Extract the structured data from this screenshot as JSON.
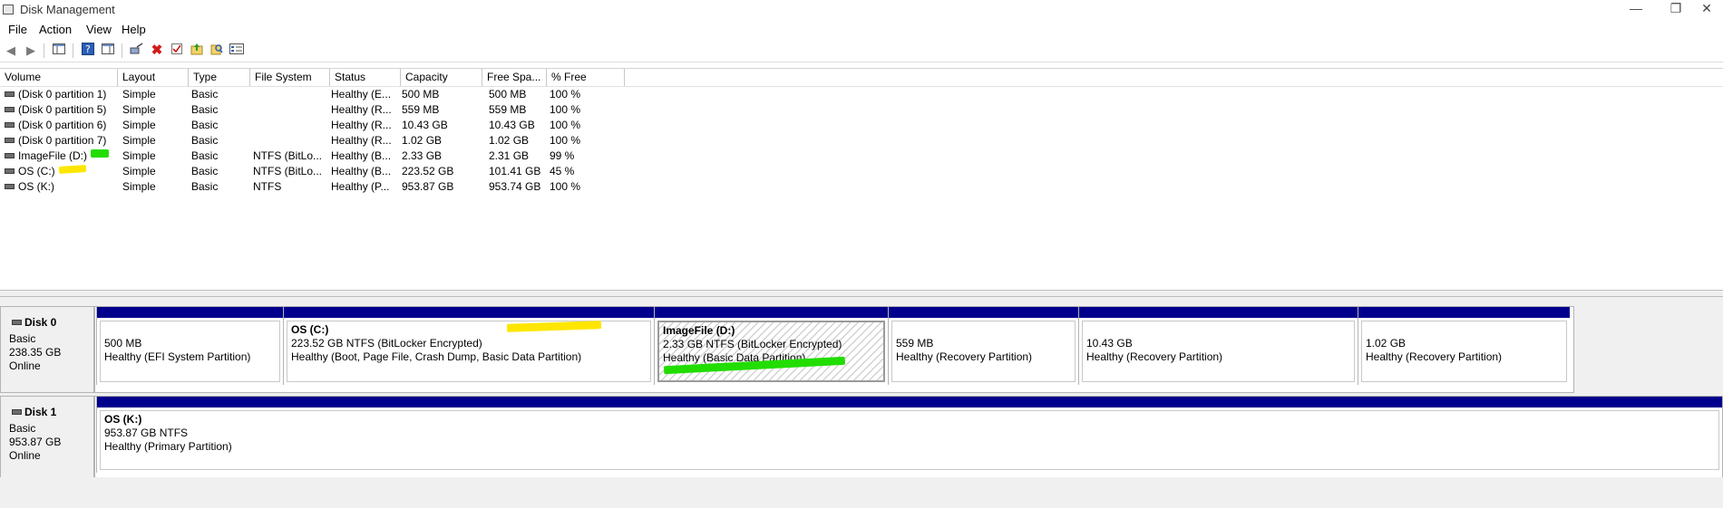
{
  "window": {
    "title": "Disk Management",
    "controls": [
      "—",
      "❐",
      "✕"
    ]
  },
  "menu": [
    "File",
    "Action",
    "View",
    "Help"
  ],
  "toolbar_icons": [
    "back-arrow-icon",
    "forward-arrow-icon",
    "console-tree-icon",
    "help-icon",
    "show-pane-icon",
    "connect-icon",
    "delete-icon",
    "properties-icon",
    "import-icon",
    "search-icon",
    "list-view-icon"
  ],
  "columns": [
    "Volume",
    "Layout",
    "Type",
    "File System",
    "Status",
    "Capacity",
    "Free Spa...",
    "% Free"
  ],
  "volumes": [
    {
      "volume": "(Disk 0 partition 1)",
      "layout": "Simple",
      "type": "Basic",
      "fs": "",
      "status": "Healthy (E...",
      "capacity": "500 MB",
      "free": "500 MB",
      "pct": "100 %"
    },
    {
      "volume": "(Disk 0 partition 5)",
      "layout": "Simple",
      "type": "Basic",
      "fs": "",
      "status": "Healthy (R...",
      "capacity": "559 MB",
      "free": "559 MB",
      "pct": "100 %"
    },
    {
      "volume": "(Disk 0 partition 6)",
      "layout": "Simple",
      "type": "Basic",
      "fs": "",
      "status": "Healthy (R...",
      "capacity": "10.43 GB",
      "free": "10.43 GB",
      "pct": "100 %"
    },
    {
      "volume": "(Disk 0 partition 7)",
      "layout": "Simple",
      "type": "Basic",
      "fs": "",
      "status": "Healthy (R...",
      "capacity": "1.02 GB",
      "free": "1.02 GB",
      "pct": "100 %"
    },
    {
      "volume": "ImageFile (D:)",
      "layout": "Simple",
      "type": "Basic",
      "fs": "NTFS (BitLo...",
      "status": "Healthy (B...",
      "capacity": "2.33 GB",
      "free": "2.31 GB",
      "pct": "99 %"
    },
    {
      "volume": "OS (C:)",
      "layout": "Simple",
      "type": "Basic",
      "fs": "NTFS (BitLo...",
      "status": "Healthy (B...",
      "capacity": "223.52 GB",
      "free": "101.41 GB",
      "pct": "45 %"
    },
    {
      "volume": "OS (K:)",
      "layout": "Simple",
      "type": "Basic",
      "fs": "NTFS",
      "status": "Healthy (P...",
      "capacity": "953.87 GB",
      "free": "953.74 GB",
      "pct": "100 %"
    }
  ],
  "highlight_colors": {
    "green": "#22dd00",
    "yellow": "#ffe600"
  },
  "disks": [
    {
      "name": "Disk 0",
      "type": "Basic",
      "size": "238.35 GB",
      "state": "Online",
      "partitions": [
        {
          "name": "",
          "size": "500 MB",
          "status": "Healthy (EFI System Partition)"
        },
        {
          "name": "OS  (C:)",
          "size": "223.52 GB NTFS (BitLocker Encrypted)",
          "status": "Healthy (Boot, Page File, Crash Dump, Basic Data Partition)"
        },
        {
          "name": "ImageFile  (D:)",
          "size": "2.33 GB NTFS (BitLocker Encrypted)",
          "status": "Healthy (Basic Data Partition)"
        },
        {
          "name": "",
          "size": "559 MB",
          "status": "Healthy (Recovery Partition)"
        },
        {
          "name": "",
          "size": "10.43 GB",
          "status": "Healthy (Recovery Partition)"
        },
        {
          "name": "",
          "size": "1.02 GB",
          "status": "Healthy (Recovery Partition)"
        }
      ]
    },
    {
      "name": "Disk 1",
      "type": "Basic",
      "size": "953.87 GB",
      "state": "Online",
      "partitions": [
        {
          "name": "OS  (K:)",
          "size": "953.87 GB NTFS",
          "status": "Healthy (Primary Partition)"
        }
      ]
    }
  ]
}
